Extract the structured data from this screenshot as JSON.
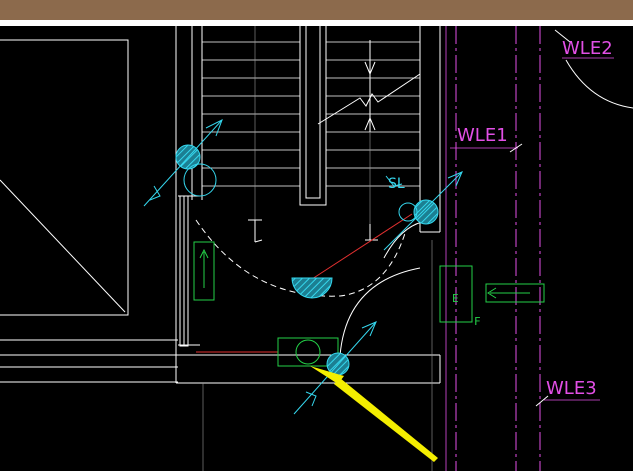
{
  "labels": {
    "wle1": "WLE1",
    "wle2": "WLE2",
    "wle3": "WLE3",
    "sl": "SL",
    "e": "E",
    "f": "F"
  },
  "colors": {
    "background": "#000000",
    "title_bar": "#8c6a4c",
    "walls": "#ffffff",
    "grid_lines": "#e24fe6",
    "equipment": "#24d148",
    "fixtures": "#35d7ee",
    "red_line": "#e23030",
    "pointer": "#f4ee00"
  },
  "icons": {
    "pointer": "yellow-arrow-icon",
    "fixture": "cyan-hatched-light-icon",
    "equipment": "green-equipment-box-icon"
  }
}
